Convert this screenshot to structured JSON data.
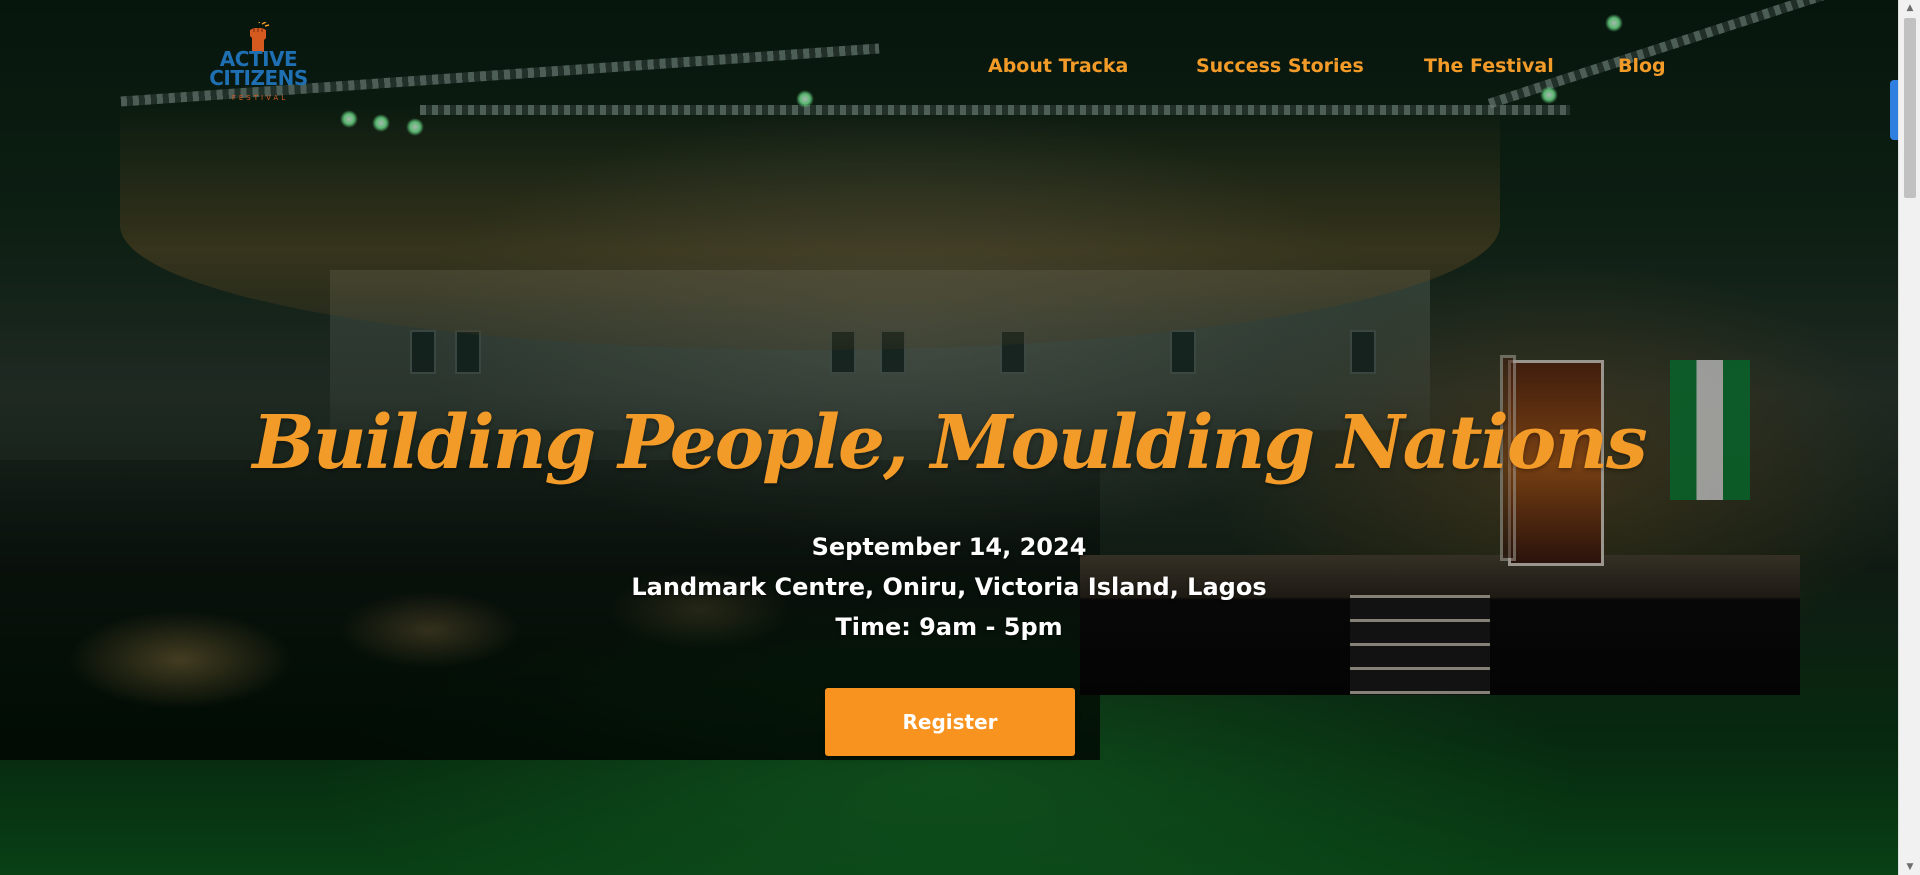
{
  "logo": {
    "text_line1": "ACTIVE",
    "text_line2": "CITIZENS",
    "subtext": "FESTIVAL",
    "brand_blue": "#1f6fb3",
    "brand_orange": "#d45a1f"
  },
  "nav": {
    "items": [
      {
        "label": "About Tracka"
      },
      {
        "label": "Success Stories"
      },
      {
        "label": "The Festival"
      },
      {
        "label": "Blog"
      }
    ]
  },
  "hero": {
    "title": "Building People, Moulding Nations",
    "date": "September 14, 2024",
    "venue": "Landmark Centre, Oniru, Victoria Island, Lagos",
    "time": "Time: 9am - 5pm",
    "register_label": "Register"
  },
  "theme": {
    "accent": "#f39b28",
    "button": "#f7931e",
    "text_light": "#ffffff"
  },
  "icons": {
    "scroll_up": "arrow-up-icon",
    "scroll_down": "arrow-down-icon",
    "logo_fist": "raised-fist-icon"
  }
}
